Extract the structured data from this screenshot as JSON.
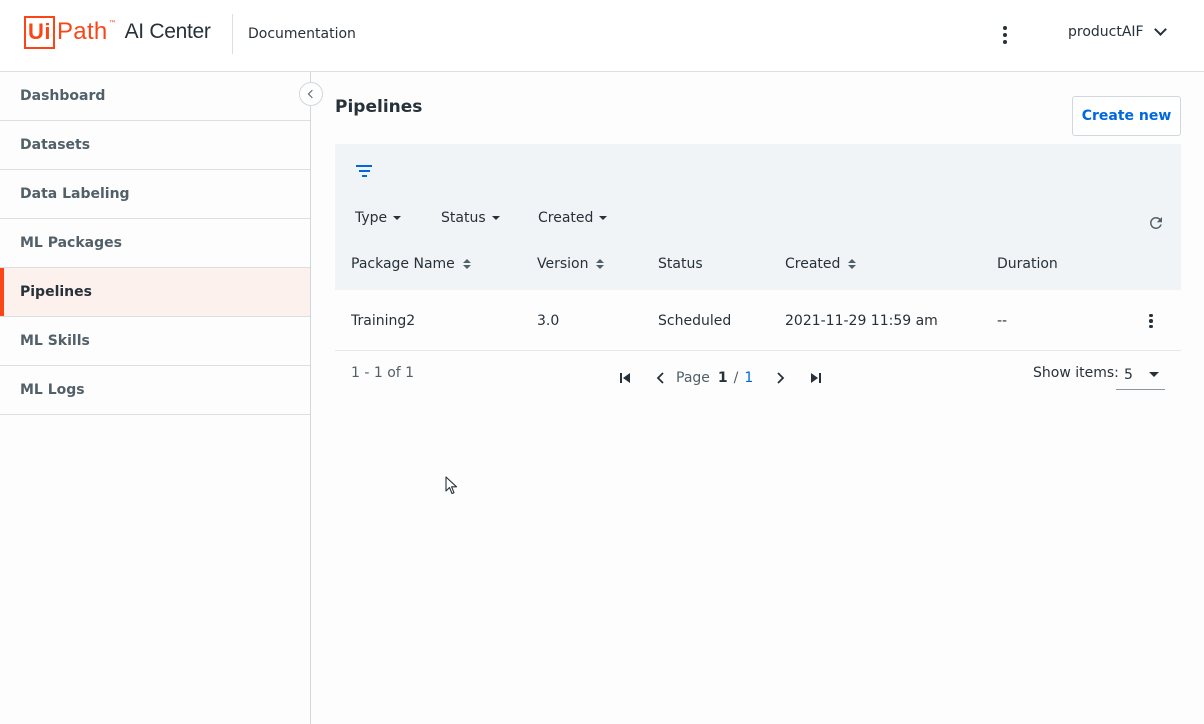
{
  "header": {
    "logo_ui": "Ui",
    "logo_path": "Path",
    "logo_tm": "™",
    "product": "AI Center",
    "doc_link": "Documentation",
    "tenant": "productAIF"
  },
  "sidebar": {
    "items": [
      {
        "label": "Dashboard",
        "active": false
      },
      {
        "label": "Datasets",
        "active": false
      },
      {
        "label": "Data Labeling",
        "active": false
      },
      {
        "label": "ML Packages",
        "active": false
      },
      {
        "label": "Pipelines",
        "active": true
      },
      {
        "label": "ML Skills",
        "active": false
      },
      {
        "label": "ML Logs",
        "active": false
      }
    ]
  },
  "main": {
    "title": "Pipelines",
    "create_label": "Create new",
    "filters": {
      "type": "Type",
      "status": "Status",
      "created": "Created"
    },
    "columns": {
      "package_name": "Package Name",
      "version": "Version",
      "status": "Status",
      "created": "Created",
      "duration": "Duration"
    },
    "rows": [
      {
        "package_name": "Training2",
        "version": "3.0",
        "status": "Scheduled",
        "created": "2021-11-29 11:59 am",
        "duration": "--"
      }
    ],
    "pagination": {
      "range": "1 - 1 of 1",
      "page_label": "Page",
      "current": "1",
      "separator": "/",
      "total": "1",
      "show_items_label": "Show items:",
      "show_items_value": "5"
    }
  },
  "colors": {
    "brand": "#fa4616",
    "accent": "#0067df",
    "active_bg": "#fdf1ee"
  }
}
